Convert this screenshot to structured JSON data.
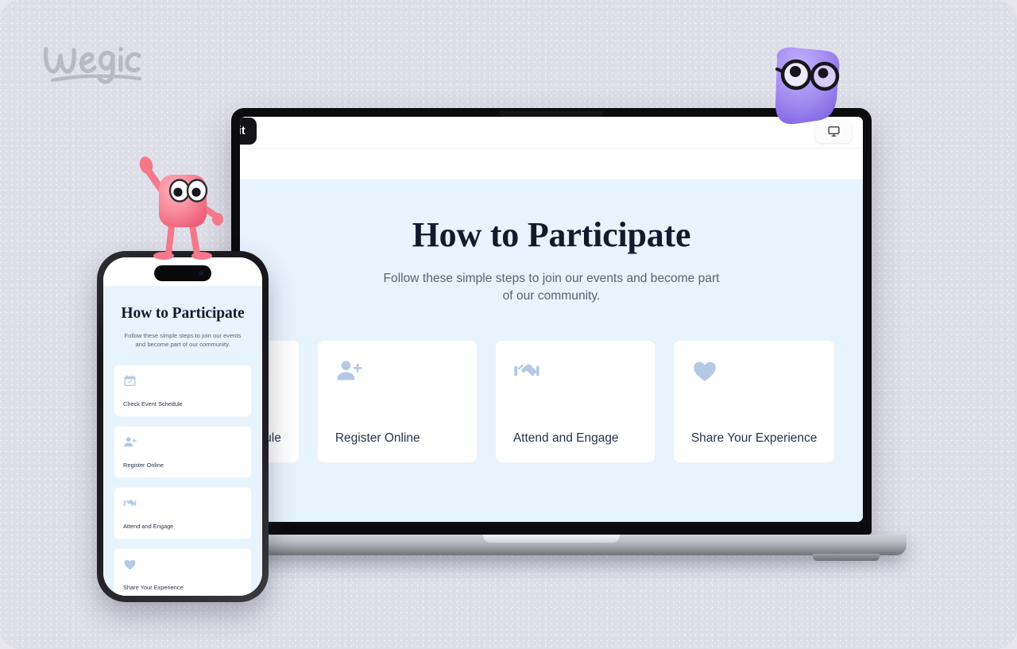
{
  "brand": {
    "logo_text": "wegic"
  },
  "editor": {
    "edit_pill_label": "to Edit",
    "device_toggle_icon": "desktop-monitor-icon"
  },
  "site": {
    "title": "How to Participate",
    "subtitle": "Follow these simple steps to join our events and become part of our community.",
    "background_color": "#e7f3fd",
    "title_color": "#121a2e",
    "icon_color": "#b4c9e5",
    "cards": [
      {
        "label": "Check Event Schedule",
        "icon": "calendar-check-icon"
      },
      {
        "label": "Register Online",
        "icon": "person-add-icon"
      },
      {
        "label": "Attend and Engage",
        "icon": "handshake-icon"
      },
      {
        "label": "Share Your Experience",
        "icon": "heart-icon"
      }
    ]
  },
  "mascots": {
    "pink": {
      "name": "pink-blob-mascot",
      "color": "#f2788a"
    },
    "purple": {
      "name": "purple-glasses-mascot",
      "color": "#9b84ee"
    }
  },
  "canvas": {
    "background_color": "#dedee8"
  }
}
